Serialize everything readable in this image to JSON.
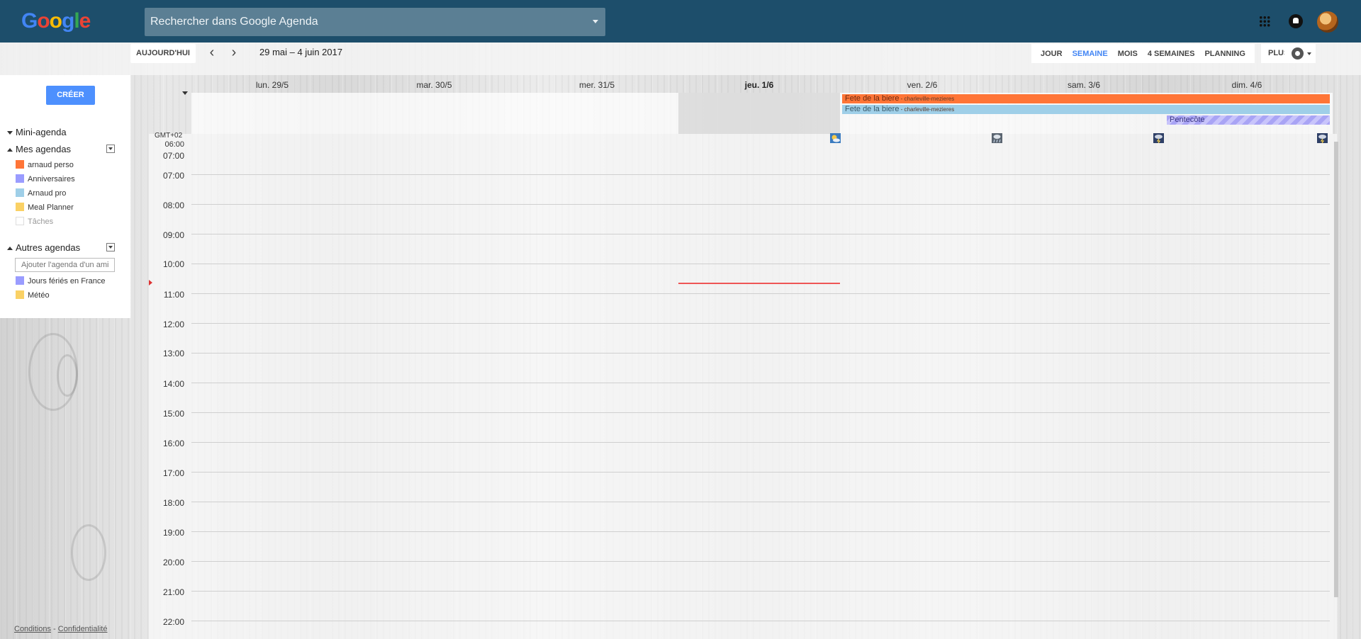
{
  "topbar": {
    "search_placeholder": "Rechercher dans Google Agenda"
  },
  "toolbar": {
    "today_label": "AUJOURD'HUI",
    "prev_label": "‹",
    "next_label": "›",
    "date_range": "29 mai – 4 juin 2017",
    "views": [
      {
        "label": "JOUR",
        "active": false
      },
      {
        "label": "SEMAINE",
        "active": true
      },
      {
        "label": "MOIS",
        "active": false
      },
      {
        "label": "4 SEMAINES",
        "active": false
      },
      {
        "label": "PLANNING",
        "active": false
      }
    ],
    "more_label": "PLUS"
  },
  "sidebar": {
    "create_label": "CRÉER",
    "mini_agenda_label": "Mini-agenda",
    "my_calendars_label": "Mes agendas",
    "my_calendars": [
      {
        "label": "arnaud perso",
        "color": "#ff7537"
      },
      {
        "label": "Anniversaires",
        "color": "#9a9cff"
      },
      {
        "label": "Arnaud pro",
        "color": "#9fcfe8"
      },
      {
        "label": "Meal Planner",
        "color": "#fad165"
      },
      {
        "label": "Tâches",
        "color": "#ffffff"
      }
    ],
    "other_calendars_label": "Autres agendas",
    "add_friend_placeholder": "Ajouter l'agenda d'un ami",
    "other_calendars": [
      {
        "label": "Jours fériés en France",
        "color": "#9a9cff"
      },
      {
        "label": "Météo",
        "color": "#fad165"
      }
    ],
    "footer": {
      "conditions": "Conditions",
      "separator": " - ",
      "privacy": "Confidentialité"
    }
  },
  "grid": {
    "timezone": "GMT+02",
    "days": [
      {
        "label": "lun. 29/5",
        "today": false
      },
      {
        "label": "mar. 30/5",
        "today": false
      },
      {
        "label": "mer. 31/5",
        "today": false
      },
      {
        "label": "jeu. 1/6",
        "today": true
      },
      {
        "label": "ven. 2/6",
        "today": false
      },
      {
        "label": "sam. 3/6",
        "today": false
      },
      {
        "label": "dim. 4/6",
        "today": false
      }
    ],
    "hours": [
      "06:00",
      "07:00",
      "07:00",
      "08:00",
      "09:00",
      "10:00",
      "11:00",
      "12:00",
      "13:00",
      "14:00",
      "15:00",
      "16:00",
      "17:00",
      "18:00",
      "19:00",
      "20:00",
      "21:00",
      "22:00"
    ],
    "allday_events": [
      {
        "title": "Fete de la biere",
        "location": " - charleville-mezieres",
        "calendar": "arnaud perso",
        "start_day": "ven. 2/6",
        "end_day": "dim. 4/6",
        "color": "#ff7537"
      },
      {
        "title": "Fete de la biere",
        "location": " - charleville-mezieres",
        "calendar": "Arnaud pro",
        "start_day": "ven. 2/6",
        "end_day": "dim. 4/6",
        "color": "#9fcfe8"
      },
      {
        "title": "Pentecôte",
        "location": "",
        "calendar": "Jours fériés en France",
        "start_day": "dim. 4/6",
        "end_day": "dim. 4/6",
        "color": "#a9a4f5"
      }
    ],
    "weather_icons": [
      {
        "day": "jeu. 1/6",
        "icon": "sun-cloud-icon"
      },
      {
        "day": "sam. 3/6",
        "icon": "rain-icon"
      },
      {
        "day": "dim. 4/6",
        "icon": "storm-icon"
      },
      {
        "day": "dim. 4/6 end",
        "icon": "storm-icon"
      }
    ]
  }
}
